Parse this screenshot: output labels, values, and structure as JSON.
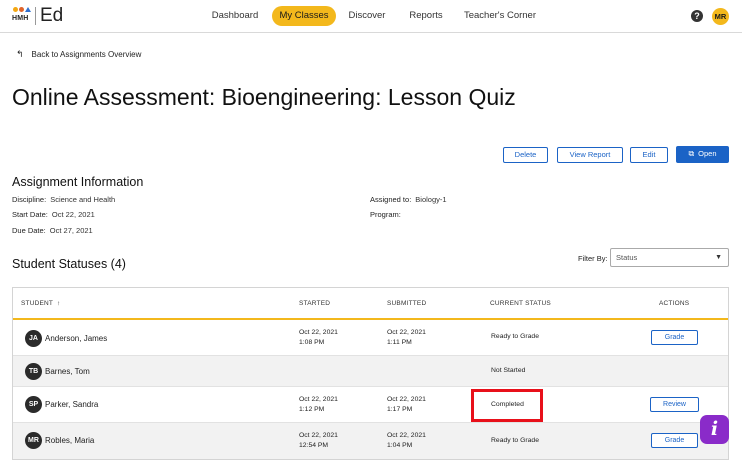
{
  "brand": {
    "logo_text": "HMH",
    "app_name": "Ed"
  },
  "nav": {
    "items": [
      {
        "label": "Dashboard",
        "active": false
      },
      {
        "label": "My Classes",
        "active": true
      },
      {
        "label": "Discover",
        "active": false
      },
      {
        "label": "Reports",
        "active": false
      },
      {
        "label": "Teacher's Corner",
        "active": false
      }
    ]
  },
  "user": {
    "initials": "MR",
    "help_glyph": "?"
  },
  "back_link": {
    "label": "Back to Assignments Overview",
    "icon": "back-arrow-icon"
  },
  "page_title": "Online Assessment: Bioengineering: Lesson Quiz",
  "actions": {
    "delete": "Delete",
    "view_report": "View Report",
    "edit": "Edit",
    "open": "Open"
  },
  "assignment_info": {
    "heading": "Assignment Information",
    "discipline_label": "Discipline:",
    "discipline": "Science and Health",
    "start_label": "Start Date:",
    "start_date": "Oct 22, 2021",
    "due_label": "Due Date:",
    "due_date": "Oct 27, 2021",
    "assigned_label": "Assigned to:",
    "assigned_to": "Biology-1",
    "program_label": "Program:",
    "program": ""
  },
  "student_statuses": {
    "heading": "Student Statuses (4)",
    "filter_label": "Filter By:",
    "filter_value": "Status"
  },
  "table": {
    "headers": {
      "student": "STUDENT",
      "sort_icon": "↑",
      "started": "STARTED",
      "submitted": "SUBMITTED",
      "status": "CURRENT STATUS",
      "actions": "ACTIONS"
    },
    "rows": [
      {
        "initials": "JA",
        "name": "Anderson, James",
        "started_date": "Oct 22, 2021",
        "started_time": "1:08 PM",
        "submitted_date": "Oct 22, 2021",
        "submitted_time": "1:11 PM",
        "status": "Ready to Grade",
        "action": "Grade"
      },
      {
        "initials": "TB",
        "name": "Barnes, Tom",
        "started_date": "",
        "started_time": "",
        "submitted_date": "",
        "submitted_time": "",
        "status": "Not Started",
        "action": ""
      },
      {
        "initials": "SP",
        "name": "Parker, Sandra",
        "started_date": "Oct 22, 2021",
        "started_time": "1:12 PM",
        "submitted_date": "Oct 22, 2021",
        "submitted_time": "1:17 PM",
        "status": "Completed",
        "action": "Review"
      },
      {
        "initials": "MR",
        "name": "Robles, Maria",
        "started_date": "Oct 22, 2021",
        "started_time": "12:54 PM",
        "submitted_date": "Oct 22, 2021",
        "submitted_time": "1:04 PM",
        "status": "Ready to Grade",
        "action": "Grade"
      }
    ]
  },
  "colors": {
    "accent": "#f3b81c",
    "primary": "#1b63c6",
    "highlight": "#e8101a",
    "info_fab": "#8a2bc9"
  },
  "info_fab": {
    "glyph": "i"
  }
}
